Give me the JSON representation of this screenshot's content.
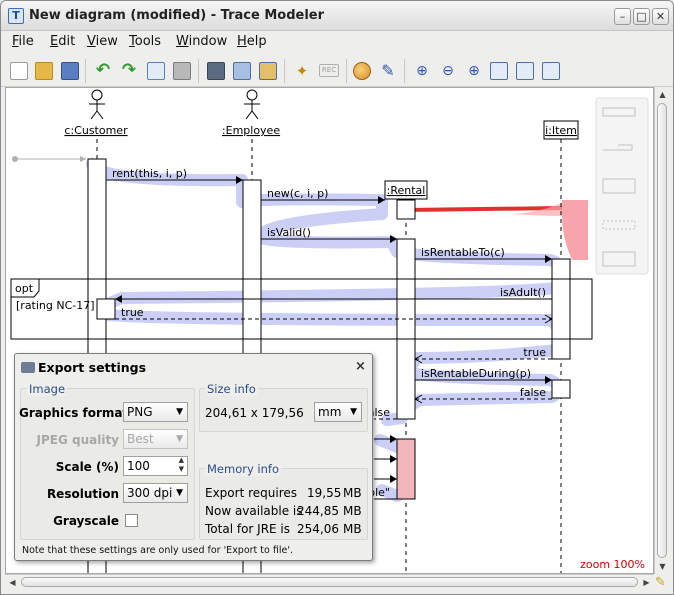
{
  "window": {
    "title": "New diagram (modified) - Trace Modeler"
  },
  "window_buttons": {
    "minimize": "–",
    "maximize": "□",
    "close": "✕"
  },
  "menu": [
    {
      "accel": "F",
      "rest": "ile"
    },
    {
      "accel": "E",
      "rest": "dit"
    },
    {
      "accel": "V",
      "rest": "iew"
    },
    {
      "accel": "T",
      "rest": "ools"
    },
    {
      "accel": "W",
      "rest": "indow"
    },
    {
      "accel": "H",
      "rest": "elp"
    }
  ],
  "toolbar_icons": [
    "new-file-icon",
    "open-folder-icon",
    "save-icon",
    "undo-icon",
    "redo-icon",
    "page-setup-icon",
    "print-icon",
    "screenshot-icon",
    "export-image-icon",
    "export-other-icon",
    "magic-wand-icon",
    "rec-icon",
    "palette-icon",
    "pencil-icon",
    "zoom-in-icon",
    "zoom-out-icon",
    "zoom-plus-icon",
    "fit-icon",
    "fit-width-icon",
    "fit-height-icon"
  ],
  "toolbar_rec_label": "REC",
  "diagram": {
    "lifelines": [
      {
        "name": "c:Customer"
      },
      {
        "name": ":Employee"
      },
      {
        "name": ":Rental"
      },
      {
        "name": "i:Item"
      }
    ],
    "messages": {
      "m1": "rent(this, i, p)",
      "m2": "new(c, i, p)",
      "m3": "isValid()",
      "m4": "isRentableTo(c)",
      "m5": "isAdult()",
      "m6": "true",
      "m7": "true",
      "m8": "isRentableDuring(p)",
      "m9": "false",
      "m10": "alse",
      "m11": "ole\""
    },
    "fragment": {
      "operator": "opt",
      "guard": "[rating NC-17]"
    },
    "zoom": "zoom 100%",
    "colors": {
      "highlight": "#c8ccf5",
      "accent_red": "#e03030",
      "pink": "#f6a6ab"
    }
  },
  "dialog": {
    "title": "Export settings",
    "close": "×",
    "image_group": "Image",
    "graphics_format_label": "Graphics format",
    "graphics_format_value": "PNG",
    "jpeg_quality_label": "JPEG quality",
    "jpeg_quality_value": "Best",
    "scale_label": "Scale (%)",
    "scale_value": "100",
    "resolution_label": "Resolution",
    "resolution_value": "300 dpi",
    "grayscale_label": "Grayscale",
    "grayscale_checked": false,
    "size_group": "Size info",
    "size_value": "204,61 x 179,56",
    "size_unit": "mm",
    "memory_group": "Memory info",
    "memory_rows": [
      {
        "label": "Export requires",
        "value": "19,55",
        "unit": "MB"
      },
      {
        "label": "Now available is",
        "value": "244,85",
        "unit": "MB"
      },
      {
        "label": "Total for JRE is",
        "value": "254,06",
        "unit": "MB"
      }
    ],
    "note": "Note that these settings are only used for 'Export to file'."
  }
}
